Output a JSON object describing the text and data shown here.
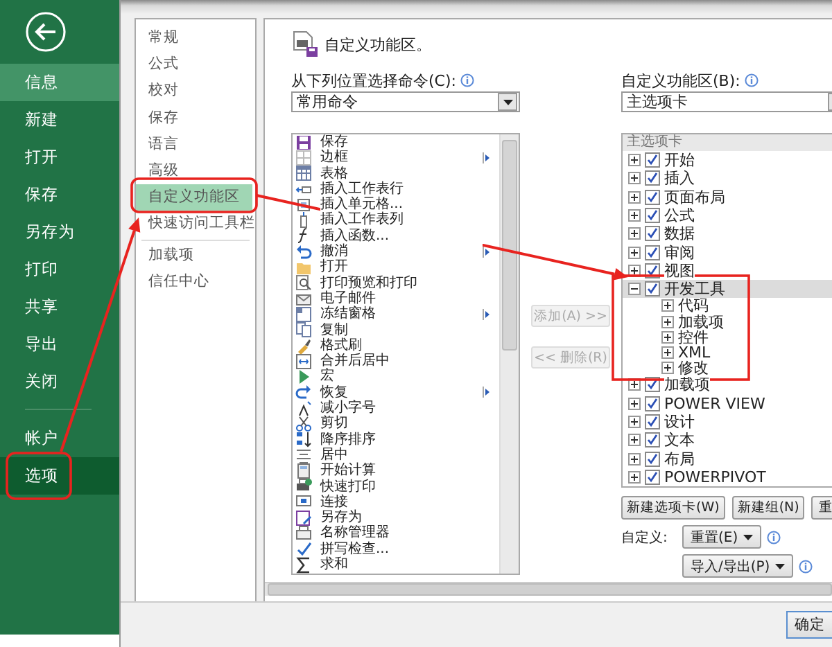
{
  "sidebar": {
    "groups": [
      [
        {
          "label": "信息",
          "selected": false,
          "highlighted": true
        },
        {
          "label": "新建",
          "selected": false,
          "highlighted": false
        },
        {
          "label": "打开",
          "selected": false,
          "highlighted": false
        },
        {
          "label": "保存",
          "selected": false,
          "highlighted": false
        },
        {
          "label": "另存为",
          "selected": false,
          "highlighted": false
        },
        {
          "label": "打印",
          "selected": false,
          "highlighted": false
        },
        {
          "label": "共享",
          "selected": false,
          "highlighted": false
        },
        {
          "label": "导出",
          "selected": false,
          "highlighted": false
        },
        {
          "label": "关闭",
          "selected": false,
          "highlighted": false
        }
      ],
      [
        {
          "label": "帐户",
          "selected": false,
          "highlighted": false
        },
        {
          "label": "选项",
          "selected": true,
          "highlighted": false
        }
      ]
    ]
  },
  "category_groups": [
    [
      {
        "label": "常规",
        "selected": false
      },
      {
        "label": "公式",
        "selected": false
      },
      {
        "label": "校对",
        "selected": false
      },
      {
        "label": "保存",
        "selected": false
      },
      {
        "label": "语言",
        "selected": false
      },
      {
        "label": "高级",
        "selected": false
      },
      {
        "label": "自定义功能区",
        "selected": true
      },
      {
        "label": "快速访问工具栏",
        "selected": false
      }
    ],
    [
      {
        "label": "加载项",
        "selected": false
      },
      {
        "label": "信任中心",
        "selected": false
      }
    ]
  ],
  "panel": {
    "title": "自定义功能区。",
    "commands_label": "从下列位置选择命令(C):",
    "commands_source": "常用命令",
    "commands": [
      {
        "label": "保存",
        "submenu": false
      },
      {
        "label": "边框",
        "submenu": true
      },
      {
        "label": "表格",
        "submenu": false
      },
      {
        "label": "插入工作表行",
        "submenu": false
      },
      {
        "label": "插入单元格...",
        "submenu": false
      },
      {
        "label": "插入工作表列",
        "submenu": false
      },
      {
        "label": "插入函数...",
        "submenu": false
      },
      {
        "label": "撤消",
        "submenu": true
      },
      {
        "label": "打开",
        "submenu": false
      },
      {
        "label": "打印预览和打印",
        "submenu": false
      },
      {
        "label": "电子邮件",
        "submenu": false
      },
      {
        "label": "冻结窗格",
        "submenu": true
      },
      {
        "label": "复制",
        "submenu": false
      },
      {
        "label": "格式刷",
        "submenu": false
      },
      {
        "label": "合并后居中",
        "submenu": false
      },
      {
        "label": "宏",
        "submenu": false
      },
      {
        "label": "恢复",
        "submenu": true
      },
      {
        "label": "减小字号",
        "submenu": false
      },
      {
        "label": "剪切",
        "submenu": false
      },
      {
        "label": "降序排序",
        "submenu": false
      },
      {
        "label": "居中",
        "submenu": false
      },
      {
        "label": "开始计算",
        "submenu": false
      },
      {
        "label": "快速打印",
        "submenu": false
      },
      {
        "label": "连接",
        "submenu": false
      },
      {
        "label": "另存为",
        "submenu": false
      },
      {
        "label": "名称管理器",
        "submenu": false
      },
      {
        "label": "拼写检查...",
        "submenu": false
      },
      {
        "label": "求和",
        "submenu": false
      }
    ],
    "add_button": {
      "label": "添加(A) >>",
      "disabled": true
    },
    "remove_button": {
      "label": "<< 删除(R)",
      "disabled": true
    },
    "ribbon_label": "自定义功能区(B):",
    "ribbon_source": "主选项卡",
    "tree_header": "主选项卡",
    "tabs": [
      {
        "label": "开始",
        "checked": true,
        "expanded": false,
        "selected": false
      },
      {
        "label": "插入",
        "checked": true,
        "expanded": false,
        "selected": false
      },
      {
        "label": "页面布局",
        "checked": true,
        "expanded": false,
        "selected": false
      },
      {
        "label": "公式",
        "checked": true,
        "expanded": false,
        "selected": false
      },
      {
        "label": "数据",
        "checked": true,
        "expanded": false,
        "selected": false
      },
      {
        "label": "审阅",
        "checked": true,
        "expanded": false,
        "selected": false
      },
      {
        "label": "视图",
        "checked": true,
        "expanded": false,
        "selected": false
      },
      {
        "label": "开发工具",
        "checked": true,
        "expanded": true,
        "selected": true,
        "children": [
          {
            "label": "代码",
            "expanded": false,
            "selected": false
          },
          {
            "label": "加载项",
            "expanded": false,
            "selected": false
          },
          {
            "label": "控件",
            "expanded": false,
            "selected": false
          },
          {
            "label": "XML",
            "expanded": false,
            "selected": false
          },
          {
            "label": "修改",
            "expanded": false,
            "selected": false
          }
        ]
      },
      {
        "label": "加载项",
        "checked": true,
        "expanded": false,
        "selected": false
      },
      {
        "label": "POWER VIEW",
        "checked": true,
        "expanded": false,
        "selected": false
      },
      {
        "label": "设计",
        "checked": true,
        "expanded": false,
        "selected": false
      },
      {
        "label": "文本",
        "checked": true,
        "expanded": false,
        "selected": false
      },
      {
        "label": "布局",
        "checked": true,
        "expanded": false,
        "selected": false
      },
      {
        "label": "POWERPIVOT",
        "checked": true,
        "expanded": false,
        "selected": false
      }
    ],
    "new_tab_button": "新建选项卡(W)",
    "new_group_button": "新建组(N)",
    "rename_button": "重",
    "customize_label": "自定义:",
    "reset_button": "重置(E)",
    "import_export_button": "导入/导出(P)"
  },
  "ok_button": "确定"
}
